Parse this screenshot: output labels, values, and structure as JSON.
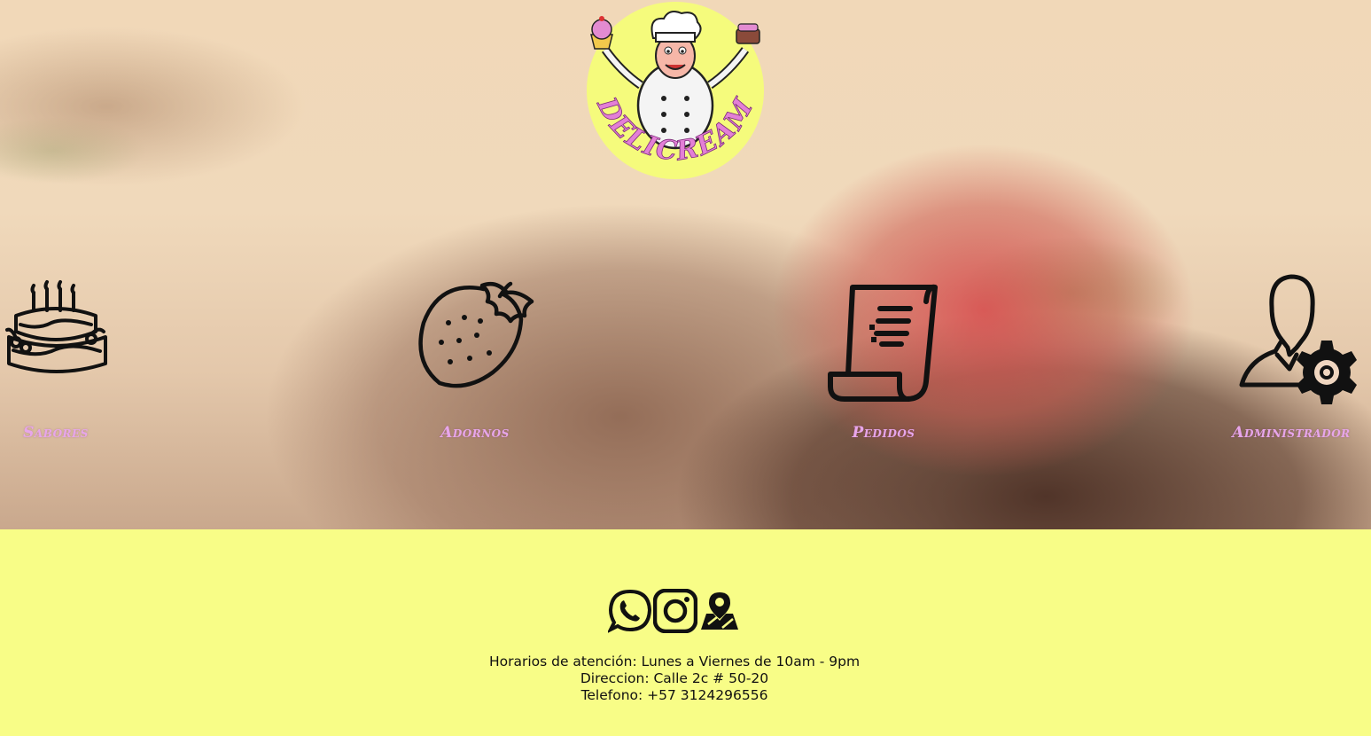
{
  "brand": {
    "logo_text": "DELICREAM"
  },
  "nav": [
    {
      "id": "sabores",
      "label": "Sabores",
      "icon": "cake-icon"
    },
    {
      "id": "adornos",
      "label": "Adornos",
      "icon": "strawberry-icon"
    },
    {
      "id": "pedidos",
      "label": "Pedidos",
      "icon": "receipt-icon"
    },
    {
      "id": "administrador",
      "label": "Administrador",
      "icon": "admin-settings-icon"
    }
  ],
  "footer": {
    "social": [
      {
        "name": "whatsapp",
        "icon": "whatsapp-icon"
      },
      {
        "name": "instagram",
        "icon": "instagram-icon"
      },
      {
        "name": "location",
        "icon": "map-location-icon"
      }
    ],
    "hours": "Horarios de atención: Lunes a Viernes de 10am - 9pm",
    "address": "Direccion: Calle 2c # 50-20",
    "phone": "Telefono: +57 3124296556"
  },
  "colors": {
    "footer_bg": "#f8fd87",
    "nav_label": "#e7a6ea",
    "logo_bg": "#f5fb7c"
  }
}
